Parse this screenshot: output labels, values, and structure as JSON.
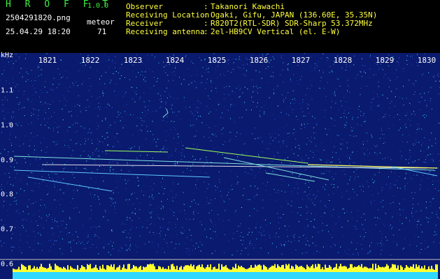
{
  "header": {
    "app_title": "H R O F F T",
    "app_version": "1.0.0",
    "file_name": "2504291820.png",
    "meteor_label": "meteor",
    "timestamp": "25.04.29 18:20",
    "meteor_count": "71"
  },
  "station_info": [
    {
      "key": "Observer",
      "value": "Takanori Kawachi"
    },
    {
      "key": "Receiving Location",
      "value": "Ogaki, Gifu, JAPAN (136.60E, 35.35N)"
    },
    {
      "key": "Receiver",
      "value": "R820T2(RTL-SDR) SDR-Sharp 53.372MHz"
    },
    {
      "key": "Receiving antenna",
      "value": "2el-HB9CV Vertical (el. E-W)"
    }
  ],
  "separator": ":",
  "spectrogram": {
    "unit_label": "kHz",
    "time_ticks": [
      "1821",
      "1822",
      "1823",
      "1824",
      "1825",
      "1826",
      "1827",
      "1828",
      "1829",
      "1830"
    ],
    "freq_ticks": [
      "1.1",
      "1.0",
      "0.9",
      "0.8",
      "0.7",
      "0.6"
    ],
    "background_color": "#0a1a6e",
    "carrier_freq_khz": 0.89,
    "meteor_count": 71
  }
}
